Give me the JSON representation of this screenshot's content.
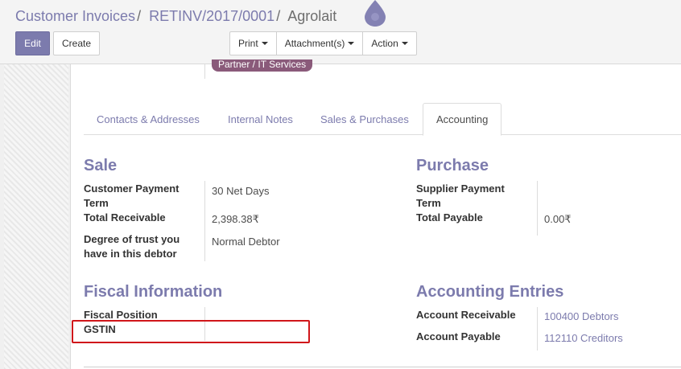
{
  "breadcrumb": {
    "items": [
      "Customer Invoices",
      "RETINV/2017/0001",
      "Agrolait"
    ],
    "separator": "/"
  },
  "toolbar": {
    "edit_label": "Edit",
    "create_label": "Create",
    "print_label": "Print",
    "attachments_label": "Attachment(s)",
    "action_label": "Action"
  },
  "tag": {
    "label": "Partner / IT Services"
  },
  "tabs": [
    {
      "label": "Contacts & Addresses"
    },
    {
      "label": "Internal Notes"
    },
    {
      "label": "Sales & Purchases"
    },
    {
      "label": "Accounting"
    }
  ],
  "sale": {
    "title": "Sale",
    "payment_term_label_1": "Customer Payment",
    "payment_term_label_2": "Term",
    "payment_term_value": "30 Net Days",
    "receivable_label": "Total Receivable",
    "receivable_value": "2,398.38₹",
    "trust_label_1": "Degree of trust you",
    "trust_label_2": "have in this debtor",
    "trust_value": "Normal Debtor"
  },
  "purchase": {
    "title": "Purchase",
    "payment_term_label_1": "Supplier Payment",
    "payment_term_label_2": "Term",
    "payable_label": "Total Payable",
    "payable_value": "0.00₹"
  },
  "fiscal": {
    "title": "Fiscal Information",
    "position_label": "Fiscal Position",
    "gstin_label": "GSTIN"
  },
  "accounting_entries": {
    "title": "Accounting Entries",
    "receivable_label": "Account Receivable",
    "receivable_value": "100400 Debtors",
    "payable_label": "Account Payable",
    "payable_value": "112110 Creditors"
  },
  "colors": {
    "brand": "#7c7bad",
    "highlight": "#d0161a",
    "tag": "#8a5a7a"
  }
}
